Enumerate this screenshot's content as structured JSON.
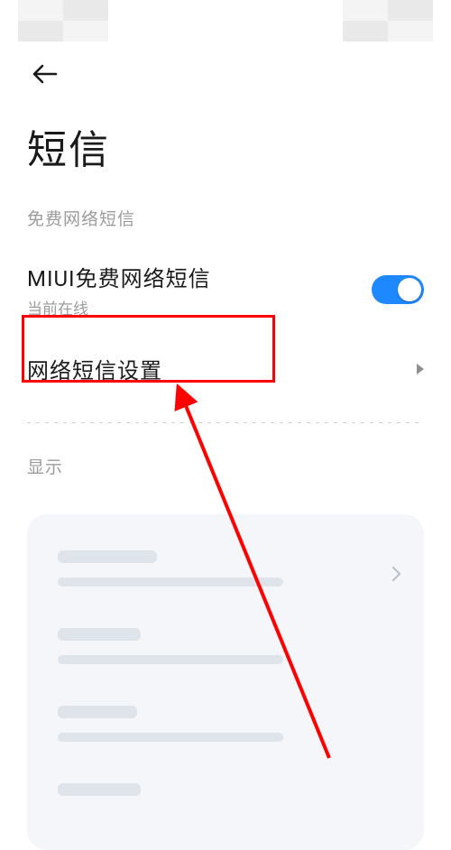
{
  "page": {
    "title": "短信"
  },
  "sections": {
    "network_sms_label": "免费网络短信",
    "display_label": "显示"
  },
  "rows": {
    "free_sms": {
      "title": "MIUI免费网络短信",
      "subtitle": "当前在线",
      "toggle_on": true
    },
    "network_settings": {
      "title": "网络短信设置"
    }
  }
}
